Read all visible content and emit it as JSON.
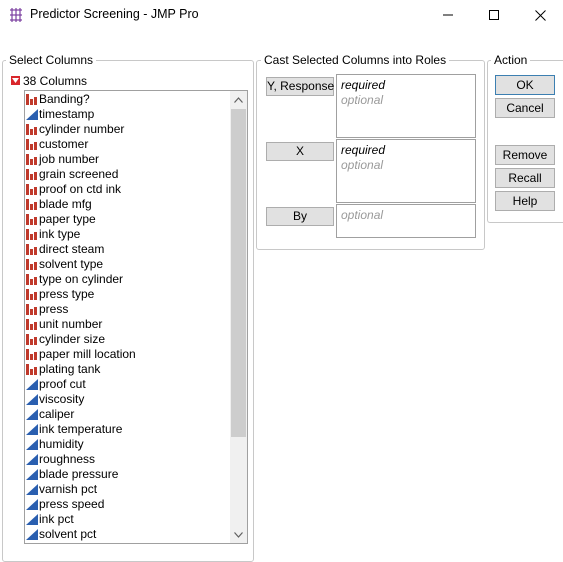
{
  "window": {
    "title": "Predictor Screening - JMP Pro",
    "icon": "jmp-app-icon",
    "controls": [
      "minimize-icon",
      "maximize-icon",
      "close-icon"
    ]
  },
  "select_columns": {
    "group_title": "Select Columns",
    "header_label": "38 Columns",
    "items": [
      {
        "label": "Banding?",
        "type": "nominal"
      },
      {
        "label": "timestamp",
        "type": "continuous"
      },
      {
        "label": "cylinder number",
        "type": "nominal"
      },
      {
        "label": "customer",
        "type": "nominal"
      },
      {
        "label": "job number",
        "type": "nominal"
      },
      {
        "label": "grain screened",
        "type": "nominal"
      },
      {
        "label": "proof on ctd ink",
        "type": "nominal"
      },
      {
        "label": "blade mfg",
        "type": "nominal"
      },
      {
        "label": "paper type",
        "type": "nominal"
      },
      {
        "label": "ink type",
        "type": "nominal"
      },
      {
        "label": "direct steam",
        "type": "nominal"
      },
      {
        "label": "solvent type",
        "type": "nominal"
      },
      {
        "label": "type on cylinder",
        "type": "nominal"
      },
      {
        "label": "press type",
        "type": "nominal"
      },
      {
        "label": "press",
        "type": "nominal"
      },
      {
        "label": "unit number",
        "type": "nominal"
      },
      {
        "label": "cylinder size",
        "type": "nominal"
      },
      {
        "label": "paper mill location",
        "type": "nominal"
      },
      {
        "label": "plating tank",
        "type": "nominal"
      },
      {
        "label": "proof cut",
        "type": "continuous"
      },
      {
        "label": "viscosity",
        "type": "continuous"
      },
      {
        "label": "caliper",
        "type": "continuous"
      },
      {
        "label": "ink temperature",
        "type": "continuous"
      },
      {
        "label": "humidity",
        "type": "continuous"
      },
      {
        "label": "roughness",
        "type": "continuous"
      },
      {
        "label": "blade pressure",
        "type": "continuous"
      },
      {
        "label": "varnish pct",
        "type": "continuous"
      },
      {
        "label": "press speed",
        "type": "continuous"
      },
      {
        "label": "ink pct",
        "type": "continuous"
      },
      {
        "label": "solvent pct",
        "type": "continuous"
      }
    ],
    "colors": {
      "nominal": "#c0392b",
      "continuous": "#2a5fb0"
    }
  },
  "roles": {
    "group_title": "Cast Selected Columns into Roles",
    "y_response": {
      "button": "Y, Response",
      "lines": [
        "required",
        "optional"
      ]
    },
    "x": {
      "button": "X",
      "lines": [
        "required",
        "optional"
      ]
    },
    "by": {
      "button": "By",
      "lines": [
        "optional"
      ]
    }
  },
  "action": {
    "group_title": "Action",
    "ok": "OK",
    "cancel": "Cancel",
    "remove": "Remove",
    "recall": "Recall",
    "help": "Help"
  }
}
